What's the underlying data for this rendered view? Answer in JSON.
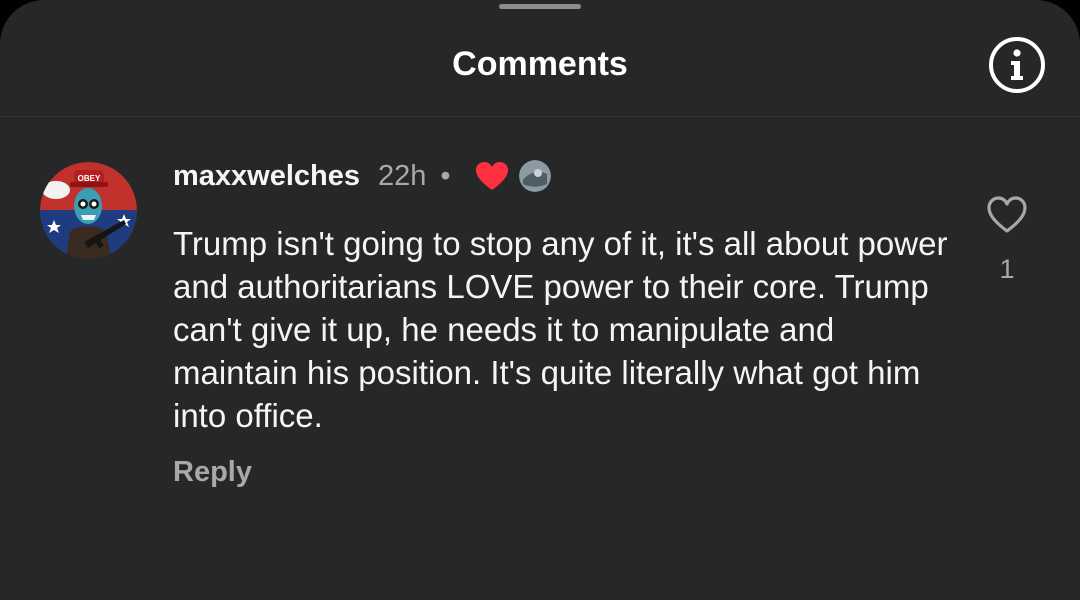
{
  "header": {
    "title": "Comments",
    "info_icon": "info-circle-icon"
  },
  "comment": {
    "username": "maxxwelches",
    "time": "22h",
    "separator": "•",
    "author_liked_icon": "red-heart-icon",
    "avatar_cap_text": "OBEY",
    "text": "Trump isn't going to stop any of it, it's all about power and authoritarians LOVE power to their core. Trump can't give it up, he needs it to manipulate and maintain his position. It's quite literally what got him into office.",
    "reply_label": "Reply",
    "like_icon": "heart-outline-icon",
    "like_count": "1"
  },
  "colors": {
    "sheet_background": "#262729",
    "primary_text": "#f5f5f5",
    "secondary_text": "#a8a8a8",
    "heart_red": "#ff3040"
  }
}
